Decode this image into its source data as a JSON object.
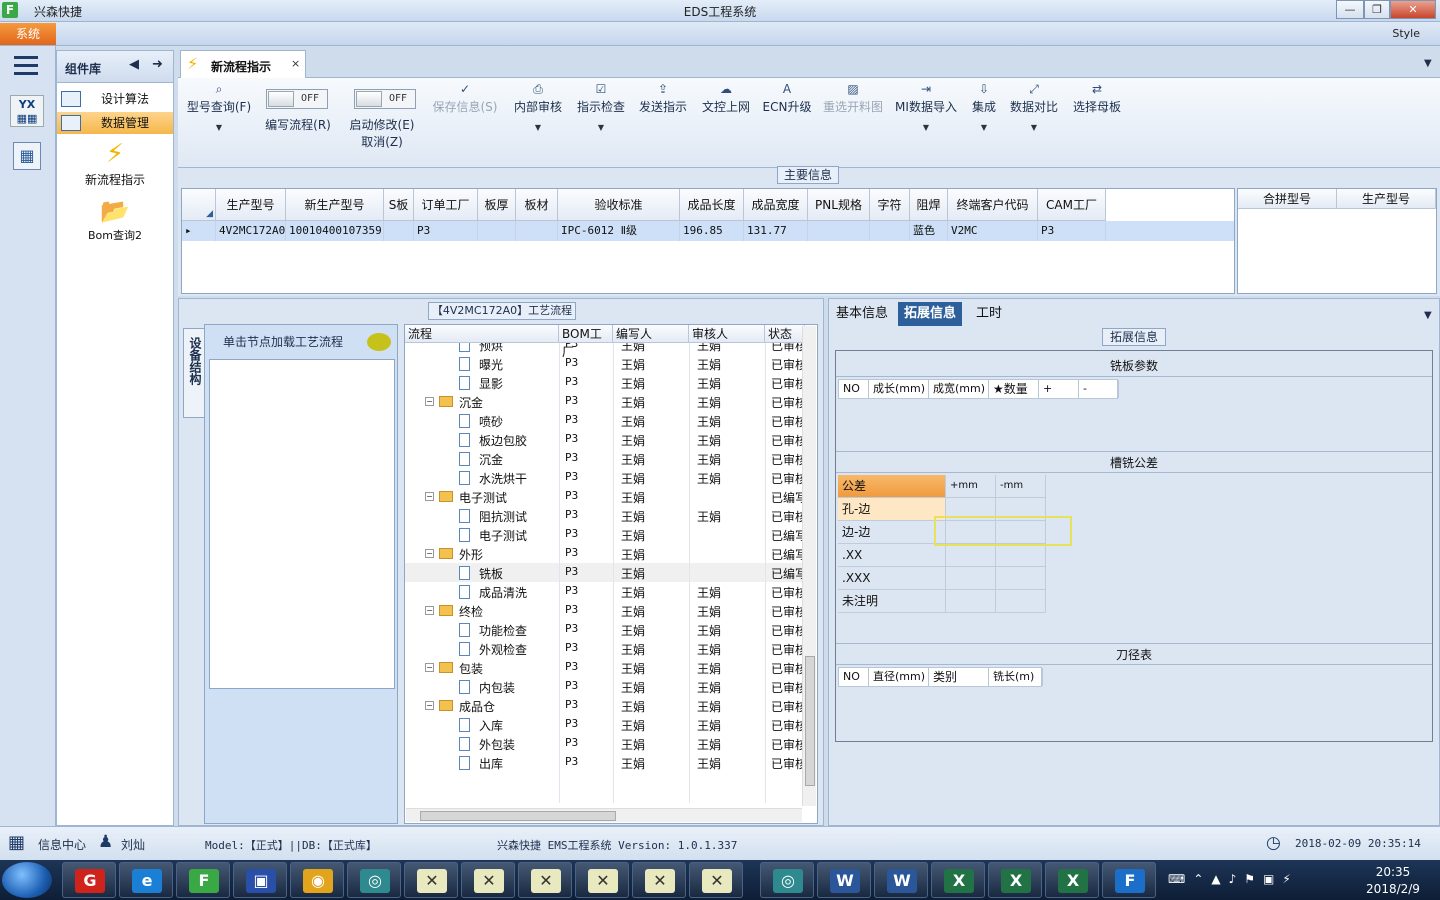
{
  "window": {
    "title": "EDS工程系统",
    "app_name": "兴森快捷",
    "controls": [
      "—",
      "❐",
      "✕"
    ]
  },
  "menubar": {
    "system": "系统",
    "style": "Style"
  },
  "components": {
    "title": "组件库",
    "items": [
      {
        "label": "设计算法"
      },
      {
        "label": "数据管理"
      }
    ],
    "big_items": [
      {
        "label": "新流程指示"
      },
      {
        "label": "Bom查询2"
      }
    ]
  },
  "doc_tab": {
    "label": "新流程指示",
    "close": "×"
  },
  "ribbon": {
    "buttons": [
      {
        "label": "型号查询(F)",
        "icon": "search-icon",
        "disabled": false
      },
      {
        "label": "保存信息(S)",
        "icon": "check-icon",
        "disabled": true
      },
      {
        "label": "内部审核",
        "icon": "print-icon",
        "disabled": false
      },
      {
        "label": "指示检查",
        "icon": "checkbox-icon",
        "disabled": false
      },
      {
        "label": "发送指示",
        "icon": "upload-icon",
        "disabled": false
      },
      {
        "label": "文控上网",
        "icon": "cloud-upload-icon",
        "disabled": false
      },
      {
        "label": "ECN升级",
        "icon": "ab-icon",
        "disabled": false
      },
      {
        "label": "重选开料图",
        "icon": "image-icon",
        "disabled": true
      },
      {
        "label": "MI数据导入",
        "icon": "import-icon",
        "disabled": false
      },
      {
        "label": "集成",
        "icon": "download-icon",
        "disabled": false
      },
      {
        "label": "数据对比",
        "icon": "compare-icon",
        "disabled": false
      },
      {
        "label": "选择母板",
        "icon": "shuffle-icon",
        "disabled": false
      }
    ],
    "toggles": [
      {
        "label": "编写流程(R)",
        "value": "OFF"
      },
      {
        "label": "启动修改(E)",
        "label2": "取消(Z)",
        "value": "OFF"
      }
    ]
  },
  "main_info": {
    "legend": "主要信息",
    "columns": [
      "生产型号",
      "新生产型号",
      "S板",
      "订单工厂",
      "板厚",
      "板材",
      "验收标准",
      "成品长度",
      "成品宽度",
      "PNL规格",
      "字符",
      "阻焊",
      "终端客户代码",
      "CAM工厂"
    ],
    "row": [
      "4V2MC172A0",
      "10010400107359",
      "",
      "P3",
      "",
      "",
      "IPC-6012 Ⅱ级",
      "196.85",
      "131.77",
      "",
      "",
      "蓝色",
      "V2MC",
      "P3"
    ],
    "side_columns": [
      "合拼型号",
      "生产型号"
    ]
  },
  "process": {
    "legend": "【4V2MC172A0】工艺流程",
    "vertical_tab": "设备结构",
    "hint": "单击节点加载工艺流程",
    "columns": [
      "流程",
      "BOM工厂",
      "编写人",
      "审核人",
      "状态"
    ],
    "rows": [
      {
        "level": 2,
        "kind": "doc",
        "name": "预烘",
        "bom": "P3",
        "writer": "王娟",
        "reviewer": "王娟",
        "status": "已审核"
      },
      {
        "level": 2,
        "kind": "doc",
        "name": "曝光",
        "bom": "P3",
        "writer": "王娟",
        "reviewer": "王娟",
        "status": "已审核"
      },
      {
        "level": 2,
        "kind": "doc",
        "name": "显影",
        "bom": "P3",
        "writer": "王娟",
        "reviewer": "王娟",
        "status": "已审核"
      },
      {
        "level": 1,
        "kind": "folder",
        "name": "沉金",
        "bom": "P3",
        "writer": "王娟",
        "reviewer": "王娟",
        "status": "已审核"
      },
      {
        "level": 2,
        "kind": "doc",
        "name": "喷砂",
        "bom": "P3",
        "writer": "王娟",
        "reviewer": "王娟",
        "status": "已审核"
      },
      {
        "level": 2,
        "kind": "doc",
        "name": "板边包胶",
        "bom": "P3",
        "writer": "王娟",
        "reviewer": "王娟",
        "status": "已审核"
      },
      {
        "level": 2,
        "kind": "doc",
        "name": "沉金",
        "bom": "P3",
        "writer": "王娟",
        "reviewer": "王娟",
        "status": "已审核"
      },
      {
        "level": 2,
        "kind": "doc",
        "name": "水洗烘干",
        "bom": "P3",
        "writer": "王娟",
        "reviewer": "王娟",
        "status": "已审核"
      },
      {
        "level": 1,
        "kind": "folder",
        "name": "电子测试",
        "bom": "P3",
        "writer": "王娟",
        "reviewer": "",
        "status": "已编写"
      },
      {
        "level": 2,
        "kind": "doc",
        "name": "阻抗测试",
        "bom": "P3",
        "writer": "王娟",
        "reviewer": "王娟",
        "status": "已审核"
      },
      {
        "level": 2,
        "kind": "doc",
        "name": "电子测试",
        "bom": "P3",
        "writer": "王娟",
        "reviewer": "",
        "status": "已编写"
      },
      {
        "level": 1,
        "kind": "folder",
        "name": "外形",
        "bom": "P3",
        "writer": "王娟",
        "reviewer": "",
        "status": "已编写"
      },
      {
        "level": 2,
        "kind": "doc",
        "name": "铣板",
        "bom": "P3",
        "writer": "王娟",
        "reviewer": "",
        "status": "已编写",
        "selected": true
      },
      {
        "level": 2,
        "kind": "doc",
        "name": "成品清洗",
        "bom": "P3",
        "writer": "王娟",
        "reviewer": "王娟",
        "status": "已审核"
      },
      {
        "level": 1,
        "kind": "folder",
        "name": "终检",
        "bom": "P3",
        "writer": "王娟",
        "reviewer": "王娟",
        "status": "已审核"
      },
      {
        "level": 2,
        "kind": "doc",
        "name": "功能检查",
        "bom": "P3",
        "writer": "王娟",
        "reviewer": "王娟",
        "status": "已审核"
      },
      {
        "level": 2,
        "kind": "doc",
        "name": "外观检查",
        "bom": "P3",
        "writer": "王娟",
        "reviewer": "王娟",
        "status": "已审核"
      },
      {
        "level": 1,
        "kind": "folder",
        "name": "包装",
        "bom": "P3",
        "writer": "王娟",
        "reviewer": "王娟",
        "status": "已审核"
      },
      {
        "level": 2,
        "kind": "doc",
        "name": "内包装",
        "bom": "P3",
        "writer": "王娟",
        "reviewer": "王娟",
        "status": "已审核"
      },
      {
        "level": 1,
        "kind": "folder",
        "name": "成品仓",
        "bom": "P3",
        "writer": "王娟",
        "reviewer": "王娟",
        "status": "已审核"
      },
      {
        "level": 2,
        "kind": "doc",
        "name": "入库",
        "bom": "P3",
        "writer": "王娟",
        "reviewer": "王娟",
        "status": "已审核"
      },
      {
        "level": 2,
        "kind": "doc",
        "name": "外包装",
        "bom": "P3",
        "writer": "王娟",
        "reviewer": "王娟",
        "status": "已审核"
      },
      {
        "level": 2,
        "kind": "doc",
        "name": "出库",
        "bom": "P3",
        "writer": "王娟",
        "reviewer": "王娟",
        "status": "已审核"
      }
    ]
  },
  "right_tabs": [
    "基本信息",
    "拓展信息",
    "工时"
  ],
  "ext_info": {
    "legend": "拓展信息",
    "mill_params": {
      "title": "铣板参数",
      "columns": [
        "NO",
        "成长(mm)",
        "成宽(mm)",
        "★数量",
        "+",
        "-"
      ]
    },
    "slot_tolerance": {
      "title": "槽铣公差",
      "header": {
        "label": "公差",
        "plus": "+mm",
        "minus": "-mm"
      },
      "rows": [
        "孔-边",
        "边-边",
        ".XX",
        ".XXX",
        "未注明"
      ]
    },
    "tool_table": {
      "title": "刀径表",
      "columns": [
        "NO",
        "直径(mm)",
        "类别",
        "铣长(m)"
      ]
    }
  },
  "statusbar": {
    "info_center": "信息中心",
    "user": "刘灿",
    "model": "Model:【正式】||DB:【正式库】",
    "version": "兴森快捷 EMS工程系统 Version: 1.0.1.337",
    "datetime": "2018-02-09 20:35:14"
  },
  "taskbar": {
    "time": "20:35",
    "date": "2018/2/9"
  }
}
